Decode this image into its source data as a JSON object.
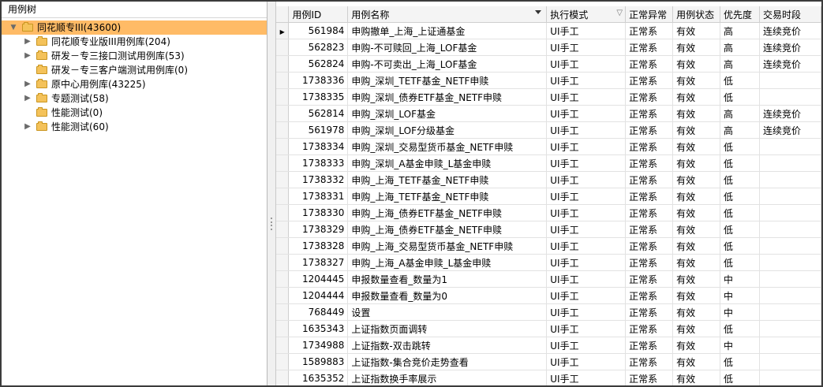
{
  "tree": {
    "header": "用例树",
    "nodes": [
      {
        "label": "同花顺专III(43600)",
        "level": 0,
        "expander": "expanded",
        "selected": true
      },
      {
        "label": "同花顺专业版III用例库(204)",
        "level": 1,
        "expander": "collapsed"
      },
      {
        "label": "研发－专三接口测试用例库(53)",
        "level": 1,
        "expander": "collapsed"
      },
      {
        "label": "研发－专三客户端测试用例库(0)",
        "level": 1,
        "expander": "none"
      },
      {
        "label": "原中心用例库(43225)",
        "level": 1,
        "expander": "collapsed"
      },
      {
        "label": "专题测试(58)",
        "level": 1,
        "expander": "collapsed"
      },
      {
        "label": "性能测试(0)",
        "level": 1,
        "expander": "none"
      },
      {
        "label": "性能测试(60)",
        "level": 1,
        "expander": "collapsed"
      }
    ]
  },
  "grid": {
    "columns": [
      {
        "key": "id",
        "label": "用例ID"
      },
      {
        "key": "name",
        "label": "用例名称"
      },
      {
        "key": "mode",
        "label": "执行模式"
      },
      {
        "key": "normal",
        "label": "正常异常"
      },
      {
        "key": "status",
        "label": "用例状态"
      },
      {
        "key": "priority",
        "label": "优先度"
      },
      {
        "key": "session",
        "label": "交易时段"
      }
    ],
    "rows": [
      [
        "561984",
        "申购撤单_上海_上证通基金",
        "UI手工",
        "正常系",
        "有效",
        "高",
        "连续竞价"
      ],
      [
        "562823",
        "申购-不可赎回_上海_LOF基金",
        "UI手工",
        "正常系",
        "有效",
        "高",
        "连续竞价"
      ],
      [
        "562824",
        "申购-不可卖出_上海_LOF基金",
        "UI手工",
        "正常系",
        "有效",
        "高",
        "连续竞价"
      ],
      [
        "1738336",
        "申购_深圳_TETF基金_NETF申赎",
        "UI手工",
        "正常系",
        "有效",
        "低",
        ""
      ],
      [
        "1738335",
        "申购_深圳_债券ETF基金_NETF申赎",
        "UI手工",
        "正常系",
        "有效",
        "低",
        ""
      ],
      [
        "562814",
        "申购_深圳_LOF基金",
        "UI手工",
        "正常系",
        "有效",
        "高",
        "连续竞价"
      ],
      [
        "561978",
        "申购_深圳_LOF分级基金",
        "UI手工",
        "正常系",
        "有效",
        "高",
        "连续竞价"
      ],
      [
        "1738334",
        "申购_深圳_交易型货币基金_NETF申赎",
        "UI手工",
        "正常系",
        "有效",
        "低",
        ""
      ],
      [
        "1738333",
        "申购_深圳_A基金申赎_L基金申赎",
        "UI手工",
        "正常系",
        "有效",
        "低",
        ""
      ],
      [
        "1738332",
        "申购_上海_TETF基金_NETF申赎",
        "UI手工",
        "正常系",
        "有效",
        "低",
        ""
      ],
      [
        "1738331",
        "申购_上海_TETF基金_NETF申赎",
        "UI手工",
        "正常系",
        "有效",
        "低",
        ""
      ],
      [
        "1738330",
        "申购_上海_债券ETF基金_NETF申赎",
        "UI手工",
        "正常系",
        "有效",
        "低",
        ""
      ],
      [
        "1738329",
        "申购_上海_债券ETF基金_NETF申赎",
        "UI手工",
        "正常系",
        "有效",
        "低",
        ""
      ],
      [
        "1738328",
        "申购_上海_交易型货币基金_NETF申赎",
        "UI手工",
        "正常系",
        "有效",
        "低",
        ""
      ],
      [
        "1738327",
        "申购_上海_A基金申赎_L基金申赎",
        "UI手工",
        "正常系",
        "有效",
        "低",
        ""
      ],
      [
        "1204445",
        "申报数量查看_数量为1",
        "UI手工",
        "正常系",
        "有效",
        "中",
        ""
      ],
      [
        "1204444",
        "申报数量查看_数量为0",
        "UI手工",
        "正常系",
        "有效",
        "中",
        ""
      ],
      [
        "768449",
        "设置",
        "UI手工",
        "正常系",
        "有效",
        "中",
        ""
      ],
      [
        "1635343",
        "上证指数页面调转",
        "UI手工",
        "正常系",
        "有效",
        "低",
        ""
      ],
      [
        "1734988",
        "上证指数-双击跳转",
        "UI手工",
        "正常系",
        "有效",
        "中",
        ""
      ],
      [
        "1589883",
        "上证指数-集合竞价走势查看",
        "UI手工",
        "正常系",
        "有效",
        "低",
        ""
      ],
      [
        "1635352",
        "上证指数换手率展示",
        "UI手工",
        "正常系",
        "有效",
        "低",
        ""
      ]
    ],
    "current_row": 0
  },
  "icons": {
    "expanded": "triangle-down-icon",
    "collapsed": "triangle-right-icon",
    "folder": "folder-icon",
    "filter": "filter-icon",
    "sort": "sort-desc-icon",
    "row_pointer": "row-pointer-icon"
  },
  "colors": {
    "selection": "#ffbb66",
    "folder": "#f4c25a",
    "header_bg": "#f4f4f4",
    "frame": "#3c3c3c"
  }
}
